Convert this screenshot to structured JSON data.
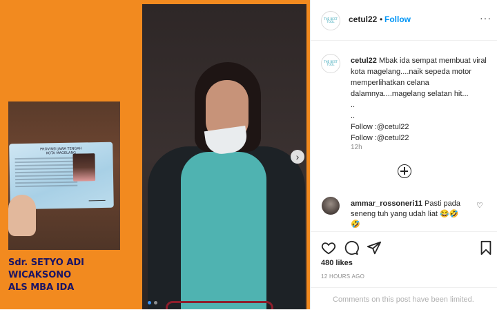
{
  "media": {
    "ktp_province": "PROVINSI JAWA TENGAH",
    "ktp_city": "KOTA MAGELANG",
    "caption_line1": "Sdr. SETYO ADI WICAKSONO",
    "caption_line2": "ALS MBA IDA"
  },
  "header": {
    "username": "cetul22",
    "separator": "•",
    "follow": "Follow",
    "more": "···",
    "avatar_text": "THE BEST TOOL"
  },
  "post_comment": {
    "username": "cetul22",
    "text": "Mbak ida sempat membuat viral kota magelang....naik sepeda motor memperlihatkan celana dalamnya....magelang selatan hit...",
    "line2": "..",
    "line3": "..",
    "line4": "Follow :@cetul22",
    "line5": "Follow :@cetul22",
    "time": "12h"
  },
  "reply": {
    "username": "ammar_rossoneri11",
    "text": "Pasti pada seneng tuh yang udah liat 😂🤣",
    "emoji2": "🤣"
  },
  "actions": {
    "likes": "480 likes",
    "ago": "12 HOURS AGO"
  },
  "footer": {
    "disabled_text": "Comments on this post have been limited."
  }
}
